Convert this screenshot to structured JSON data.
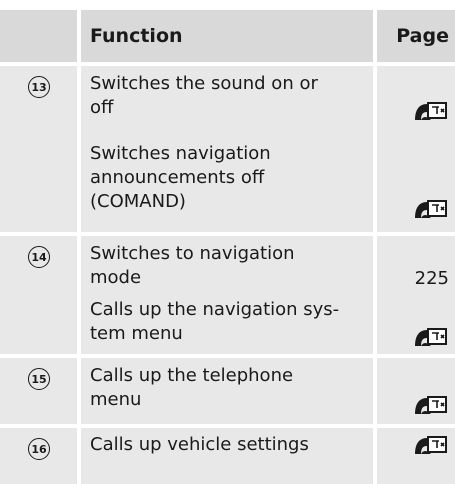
{
  "header": {
    "function_label": "Function",
    "page_label": "Page"
  },
  "rows": [
    {
      "number": "13",
      "items": [
        {
          "lines": [
            "Switches the sound on or",
            "off"
          ],
          "page": "",
          "page_is_icon": true
        },
        {
          "lines": [
            "Switches navigation",
            "announcements off",
            "(COMAND)"
          ],
          "page": "",
          "page_is_icon": true
        }
      ]
    },
    {
      "number": "14",
      "items": [
        {
          "lines": [
            "Switches to navigation",
            "mode"
          ],
          "page": "225",
          "page_is_icon": false
        },
        {
          "lines": [
            "Calls up the navigation sys-",
            "tem menu"
          ],
          "page": "",
          "page_is_icon": true
        }
      ]
    },
    {
      "number": "15",
      "items": [
        {
          "lines": [
            "Calls up the telephone",
            "menu"
          ],
          "page": "",
          "page_is_icon": true
        }
      ]
    },
    {
      "number": "16",
      "items": [
        {
          "lines": [
            "Calls up vehicle settings"
          ],
          "page": "",
          "page_is_icon": true
        }
      ]
    }
  ]
}
